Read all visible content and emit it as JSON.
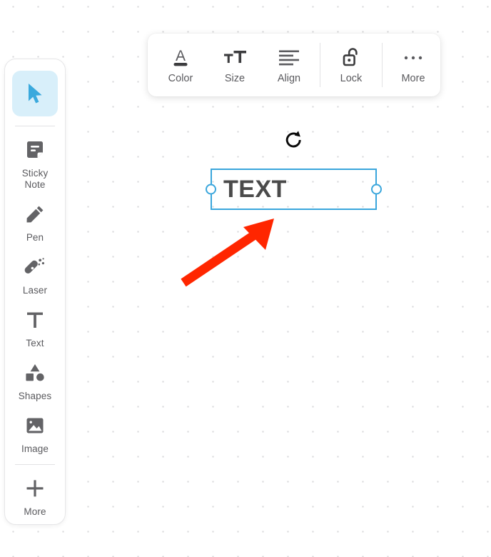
{
  "app": {
    "canvas_background": "#ffffff",
    "dot_color": "#d8d8da",
    "accent_blue": "#3aa6dc",
    "selected_tool_bg": "#d8effa",
    "annotation_color": "#ff2600"
  },
  "sidebar": {
    "items": [
      {
        "id": "select",
        "icon": "cursor-arrow-icon",
        "label": "",
        "selected": true
      },
      {
        "id": "sticky-note",
        "icon": "sticky-note-icon",
        "label": "Sticky Note",
        "selected": false
      },
      {
        "id": "pen",
        "icon": "pen-icon",
        "label": "Pen",
        "selected": false
      },
      {
        "id": "laser",
        "icon": "laser-icon",
        "label": "Laser",
        "selected": false
      },
      {
        "id": "text",
        "icon": "text-icon",
        "label": "Text",
        "selected": false
      },
      {
        "id": "shapes",
        "icon": "shapes-icon",
        "label": "Shapes",
        "selected": false
      },
      {
        "id": "image",
        "icon": "image-icon",
        "label": "Image",
        "selected": false
      },
      {
        "id": "more",
        "icon": "plus-icon",
        "label": "More",
        "selected": false
      }
    ]
  },
  "toolbar": {
    "items": [
      {
        "id": "color",
        "icon": "letter-a-underline-icon",
        "label": "Color"
      },
      {
        "id": "size",
        "icon": "font-size-icon",
        "label": "Size"
      },
      {
        "id": "align",
        "icon": "align-left-icon",
        "label": "Align"
      },
      {
        "id": "lock",
        "icon": "unlocked-padlock-icon",
        "label": "Lock"
      },
      {
        "id": "more",
        "icon": "ellipsis-icon",
        "label": "More"
      }
    ]
  },
  "selection": {
    "object_type": "text",
    "text": "TEXT",
    "rotate_icon": "rotate-icon",
    "handle_left": "resize-handle-left",
    "handle_right": "resize-handle-right"
  },
  "annotation": {
    "type": "arrow",
    "color": "#ff2600",
    "points_to": "selected-text-object"
  }
}
